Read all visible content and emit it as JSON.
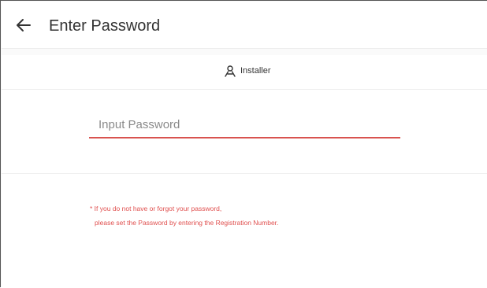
{
  "header": {
    "title": "Enter Password",
    "back_icon": "arrow-left-icon"
  },
  "role": {
    "label": "Installer",
    "icon": "installer-person-icon"
  },
  "password_field": {
    "placeholder": "Input Password",
    "value": ""
  },
  "notice": {
    "line1": "* If you do not have or forgot your password,",
    "line2": "please set the Password by entering the Registration Number."
  },
  "colors": {
    "accent_red": "#d9534f",
    "notice_red": "#e0504f"
  }
}
